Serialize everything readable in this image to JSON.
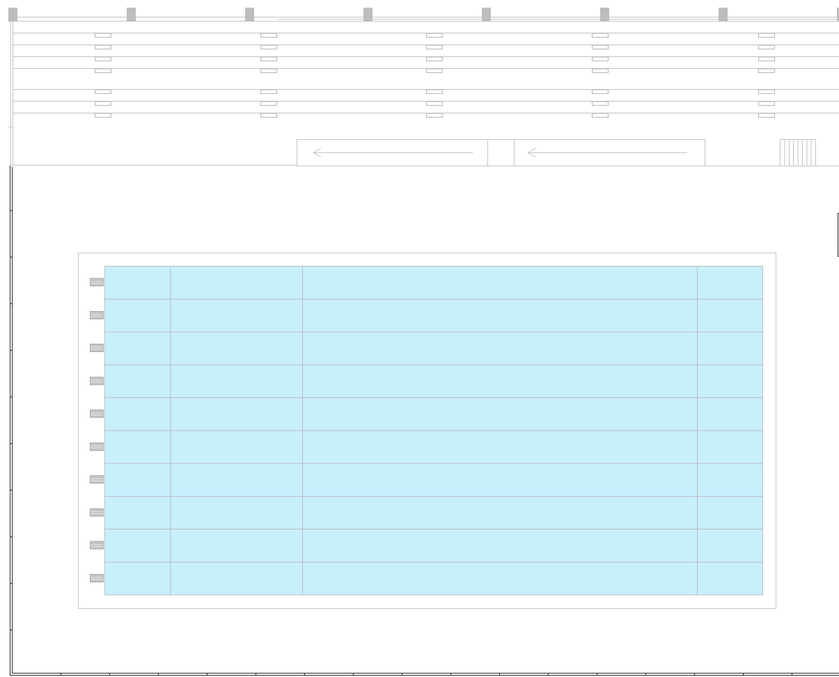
{
  "plan": {
    "column_count": 8,
    "aisle_row_count": 7,
    "stub_columns": 5,
    "one_way_arrows": [
      {
        "direction": "left"
      },
      {
        "direction": "left"
      }
    ],
    "stair_step_count": 8
  },
  "pool": {
    "rows": 10,
    "columns": 4,
    "starting_blocks": 10,
    "water_color": "#c8effc",
    "deck_border_color": "#c9c9c9"
  },
  "colors": {
    "line": "#c3c3c3",
    "column_fill": "#bdbdbd",
    "outer_wall": "#222222"
  }
}
